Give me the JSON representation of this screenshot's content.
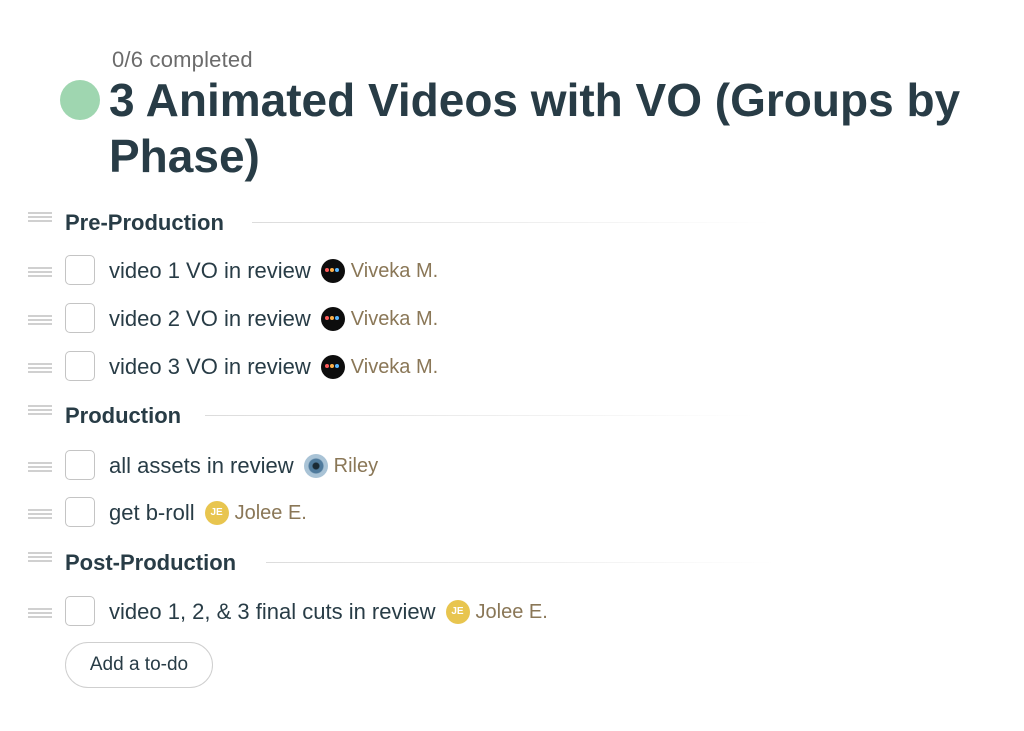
{
  "list": {
    "progress": "0/6 completed",
    "status_color": "#9fd6b0",
    "title": "3 Animated Videos with VO (Groups by Phase)"
  },
  "groups": [
    {
      "name": "Pre-Production",
      "todos": [
        {
          "text": "video 1 VO in review",
          "assignee": "Viveka M.",
          "avatar": "dark-pixel-avatar"
        },
        {
          "text": "video 2 VO in review",
          "assignee": "Viveka M.",
          "avatar": "dark-pixel-avatar"
        },
        {
          "text": "video 3 VO in review",
          "assignee": "Viveka M.",
          "avatar": "dark-pixel-avatar"
        }
      ]
    },
    {
      "name": "Production",
      "todos": [
        {
          "text": "all assets in review",
          "assignee": "Riley",
          "avatar": "eye-photo-avatar"
        },
        {
          "text": "get b-roll",
          "assignee": "Jolee E.",
          "avatar": "initials-avatar",
          "initials": "JE"
        }
      ]
    },
    {
      "name": "Post-Production",
      "todos": [
        {
          "text": "video 1, 2, & 3 final cuts in review",
          "assignee": "Jolee E.",
          "avatar": "initials-avatar",
          "initials": "JE"
        }
      ]
    }
  ],
  "actions": {
    "add_todo_label": "Add a to-do"
  },
  "colors": {
    "text": "#283c46",
    "assignee": "#8a7757",
    "avatar_initials_bg": "#e8c54f"
  }
}
